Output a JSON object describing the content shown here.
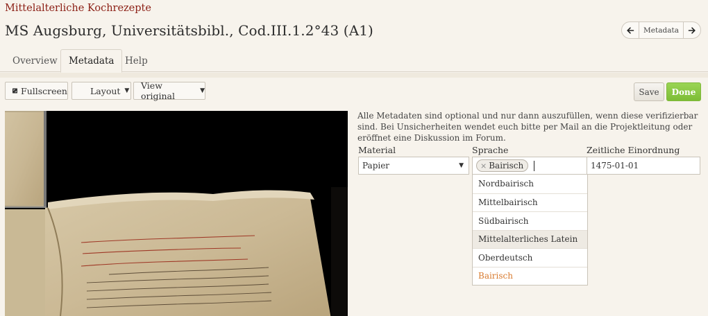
{
  "header": {
    "project": "Mittelalterliche Kochrezepte",
    "title": "MS Augsburg, Universitätsbibl., Cod.III.1.2°43 (A1)",
    "pager_label": "Metadata"
  },
  "tabs": [
    "Overview",
    "Metadata",
    "Help"
  ],
  "active_tab": "Metadata",
  "toolbar": {
    "fullscreen": "Fullscreen",
    "layout": "Layout",
    "view_original": "View original",
    "save": "Save",
    "done": "Done"
  },
  "colors": {
    "brand": "#8b1e14",
    "done_green": "#7dbd36",
    "new_option": "#d87a2e"
  },
  "metadata": {
    "intro": "Alle Metadaten sind optional und nur dann auszufüllen, wenn diese verifizierbar sind. Bei Unsicherheiten wendet euch bitte per Mail an die Projektleitung oder eröffnet eine Diskussion im Forum.",
    "material": {
      "label": "Material",
      "value": "Papier"
    },
    "sprache": {
      "label": "Sprache",
      "tags": [
        "Bairisch"
      ],
      "options": [
        "Nordbairisch",
        "Mittelbairisch",
        "Südbairisch",
        "Mittelalterliches Latein",
        "Oberdeutsch",
        "Bairisch"
      ],
      "highlighted": "Mittelalterliches Latein"
    },
    "zeit": {
      "label": "Zeitliche Einordnung",
      "value": "1475-01-01"
    }
  },
  "icons": {
    "prev": "arrow-left-icon",
    "next": "arrow-right-icon",
    "fullscreen": "fullscreen-icon",
    "caret": "caret-down-icon",
    "remove_tag": "close-icon"
  }
}
